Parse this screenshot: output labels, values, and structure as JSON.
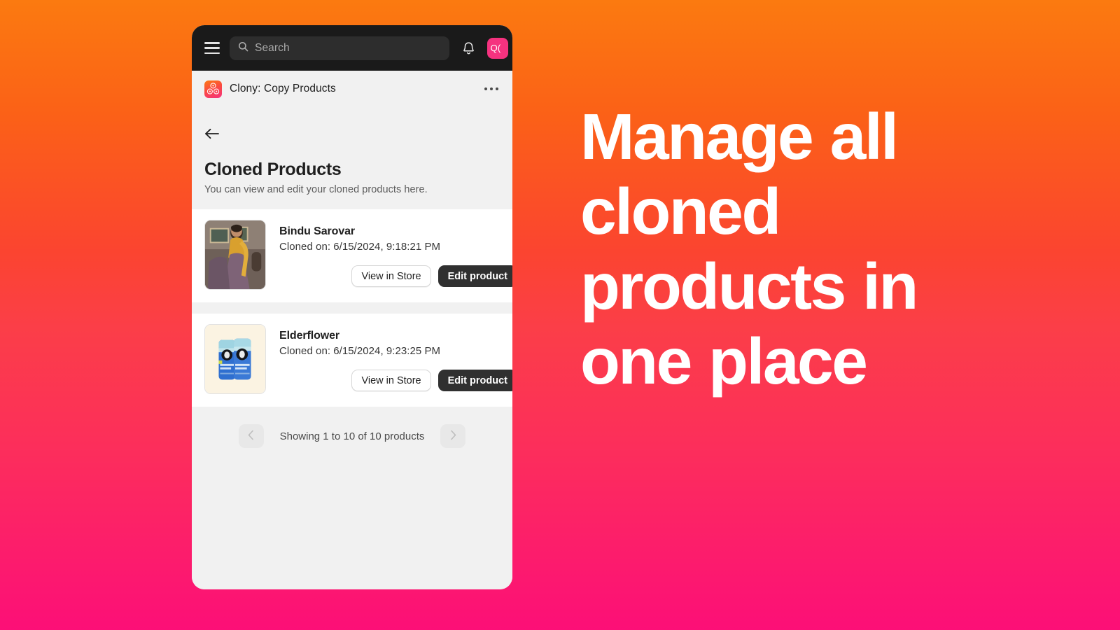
{
  "background": {
    "gradient_from": "#FB7A10",
    "gradient_mid": "#FB3E48",
    "gradient_to": "#FC0F77"
  },
  "headline": "Manage all cloned products in one place",
  "topbar": {
    "menu_icon": "hamburger-icon",
    "search": {
      "icon": "search-icon",
      "placeholder": "Search",
      "value": ""
    },
    "notifications_icon": "bell-icon",
    "avatar_initials": "Q("
  },
  "appbar": {
    "icon": "clony-app-icon",
    "title": "Clony: Copy Products",
    "more_icon": "more-horizontal-icon"
  },
  "page": {
    "back_icon": "arrow-left-icon",
    "title": "Cloned Products",
    "subtitle": "You can view and edit your cloned products here."
  },
  "products": [
    {
      "name": "Bindu Sarovar",
      "cloned_on": "Cloned on: 6/15/2024, 9:18:21 PM",
      "thumbnail": "woman-in-mustard-top-and-mauve-lehenga",
      "view_label": "View in Store",
      "edit_label": "Edit product"
    },
    {
      "name": "Elderflower",
      "cloned_on": "Cloned on: 6/15/2024, 9:23:25 PM",
      "thumbnail": "two-blue-cold-brew-coffee-cans",
      "view_label": "View in Store",
      "edit_label": "Edit product"
    }
  ],
  "pagination": {
    "prev_icon": "chevron-left-icon",
    "next_icon": "chevron-right-icon",
    "label": "Showing 1 to 10 of 10 products"
  }
}
